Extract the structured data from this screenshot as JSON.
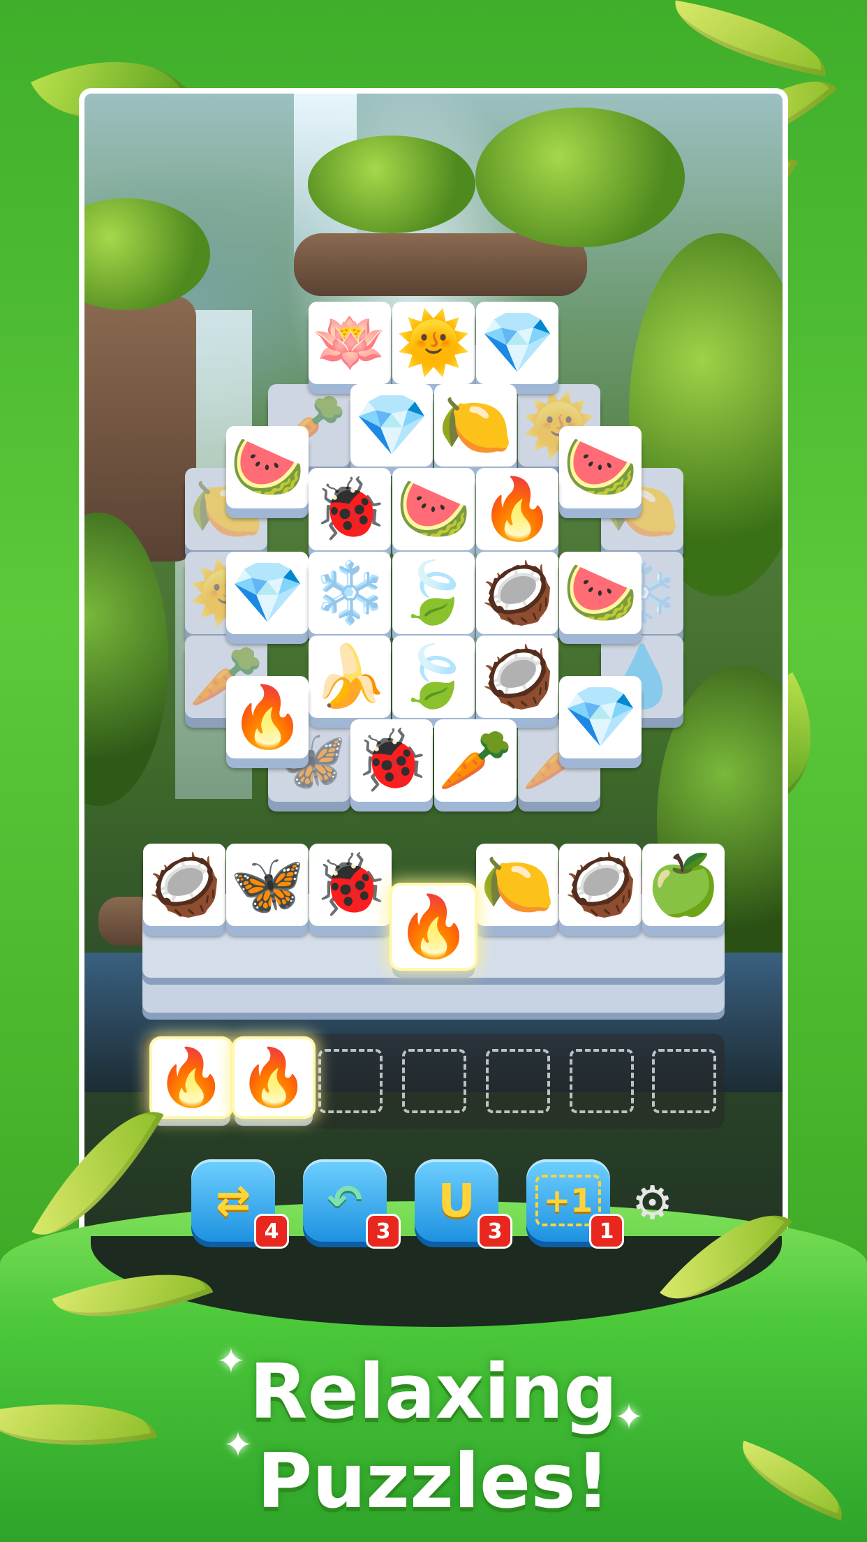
{
  "board": {
    "top_layer": [
      {
        "name": "lotus",
        "glyph": "🪷"
      },
      {
        "name": "sun",
        "glyph": "🌞"
      },
      {
        "name": "diamond",
        "glyph": "💎"
      },
      {
        "name": "diamond",
        "glyph": "💎"
      },
      {
        "name": "lemon",
        "glyph": "🍋"
      },
      {
        "name": "watermelon",
        "glyph": "🍉"
      },
      {
        "name": "watermelon",
        "glyph": "🍉"
      },
      {
        "name": "ladybug",
        "glyph": "🐞"
      },
      {
        "name": "watermelon",
        "glyph": "🍉"
      },
      {
        "name": "fire",
        "glyph": "🔥"
      },
      {
        "name": "diamond",
        "glyph": "💎"
      },
      {
        "name": "snowflake",
        "glyph": "❄️"
      },
      {
        "name": "leaf",
        "glyph": "🍃"
      },
      {
        "name": "coconut",
        "glyph": "🥥"
      },
      {
        "name": "watermelon",
        "glyph": "🍉"
      },
      {
        "name": "banana",
        "glyph": "🍌"
      },
      {
        "name": "leaf",
        "glyph": "🍃"
      },
      {
        "name": "coconut",
        "glyph": "🥥"
      },
      {
        "name": "fire",
        "glyph": "🔥"
      },
      {
        "name": "diamond",
        "glyph": "💎"
      },
      {
        "name": "ladybug",
        "glyph": "🐞"
      },
      {
        "name": "carrot",
        "glyph": "🥕"
      }
    ],
    "under_layer": [
      {
        "name": "carrot",
        "glyph": "🥕"
      },
      {
        "name": "sun",
        "glyph": "🌞"
      },
      {
        "name": "lemon",
        "glyph": "🍋"
      },
      {
        "name": "lemon",
        "glyph": "🍋"
      },
      {
        "name": "sun",
        "glyph": "🌞"
      },
      {
        "name": "snowflake",
        "glyph": "❄️"
      },
      {
        "name": "carrot",
        "glyph": "🥕"
      },
      {
        "name": "water-drop",
        "glyph": "💧"
      },
      {
        "name": "butterfly",
        "glyph": "🦋"
      },
      {
        "name": "carrot",
        "glyph": "🥕"
      }
    ],
    "stack_row": [
      {
        "name": "coconut",
        "glyph": "🥥"
      },
      {
        "name": "butterfly",
        "glyph": "🦋"
      },
      {
        "name": "ladybug",
        "glyph": "🐞"
      },
      {
        "name": "fire",
        "glyph": "🔥"
      },
      {
        "name": "lemon",
        "glyph": "🍋"
      },
      {
        "name": "coconut",
        "glyph": "🥥"
      },
      {
        "name": "apple",
        "glyph": "🍏"
      }
    ]
  },
  "tray": {
    "filled": [
      {
        "name": "fire",
        "glyph": "🔥"
      },
      {
        "name": "fire",
        "glyph": "🔥"
      }
    ],
    "capacity": 7
  },
  "boosters": [
    {
      "name": "shuffle",
      "icon": "⇄",
      "count": "4"
    },
    {
      "name": "undo",
      "icon": "↶",
      "count": "3"
    },
    {
      "name": "magnet",
      "icon": "U",
      "count": "3"
    },
    {
      "name": "extra-slot",
      "icon": "+1",
      "count": "1"
    }
  ],
  "settings": {
    "icon": "⚙"
  },
  "headline": {
    "line1": "Relaxing",
    "line2": "Puzzles!"
  },
  "colors": {
    "tile": "#ffffff",
    "tile_edge": "#9fb6d4",
    "booster": "#1e92e0",
    "badge": "#e8281e",
    "background": "#4cc83a"
  }
}
